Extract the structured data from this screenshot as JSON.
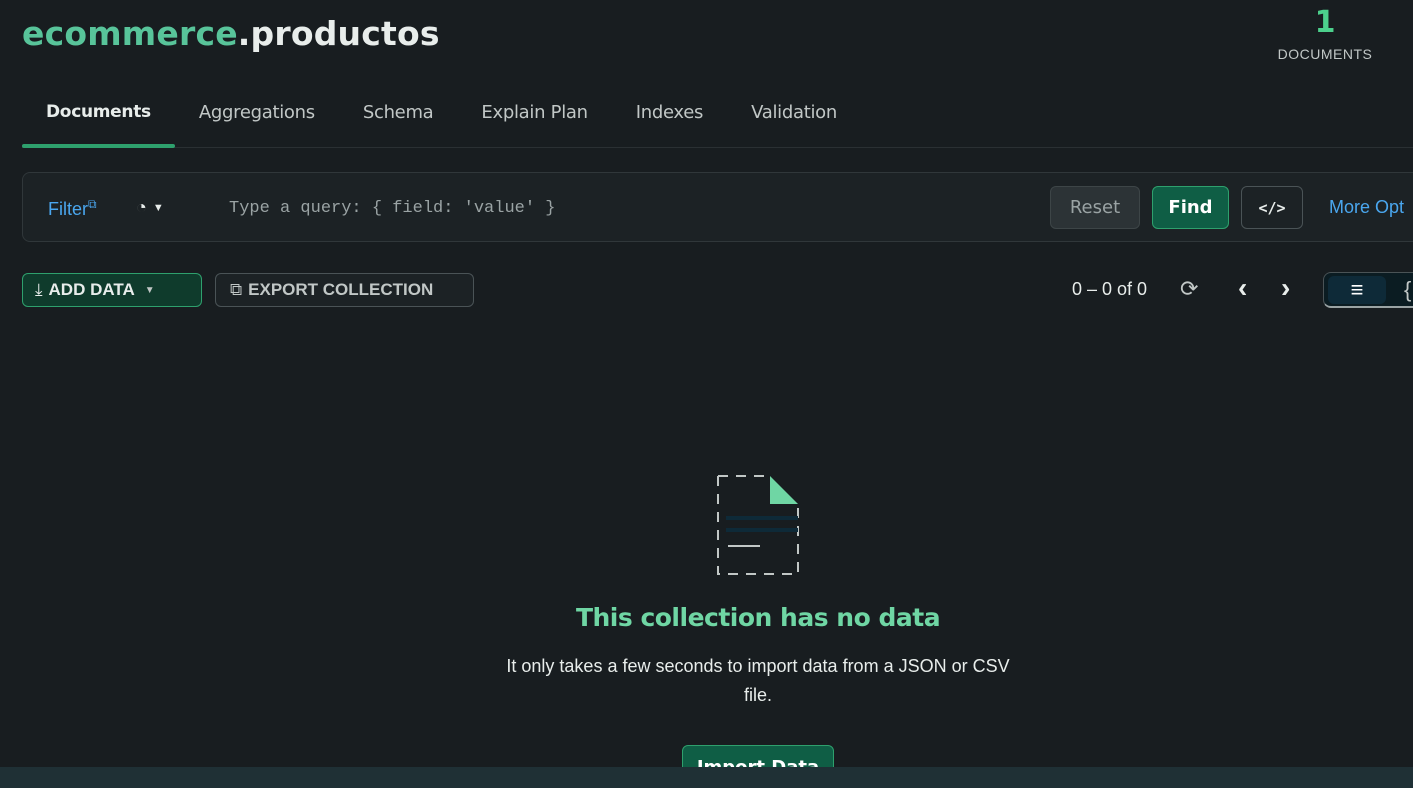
{
  "header": {
    "db_name": "ecommerce",
    "collection_name": ".productos",
    "doc_count": "1",
    "doc_count_label": "DOCUMENTS"
  },
  "tabs": [
    {
      "label": "Documents",
      "active": true
    },
    {
      "label": "Aggregations"
    },
    {
      "label": "Schema"
    },
    {
      "label": "Explain Plan"
    },
    {
      "label": "Indexes"
    },
    {
      "label": "Validation"
    }
  ],
  "query": {
    "filter_label": "Filter",
    "filter_icon": "external-link-icon",
    "history_icon": "clock-icon",
    "placeholder": "Type a query: { field: 'value' }",
    "value": "",
    "reset_label": "Reset",
    "find_label": "Find",
    "code_label": "</>",
    "more_options_label": "More Opt"
  },
  "toolbar": {
    "add_data_label": "ADD DATA",
    "export_label": "EXPORT COLLECTION",
    "pagination": "0 – 0 of 0"
  },
  "empty_state": {
    "title": "This collection has no data",
    "description_line1": "It only takes a few seconds to import data from a JSON or CSV",
    "description_line2": "file.",
    "import_label": "Import Data"
  },
  "colors": {
    "background": "#181d20",
    "accent_green": "#2ea06d",
    "link_blue": "#4aa7ef"
  }
}
